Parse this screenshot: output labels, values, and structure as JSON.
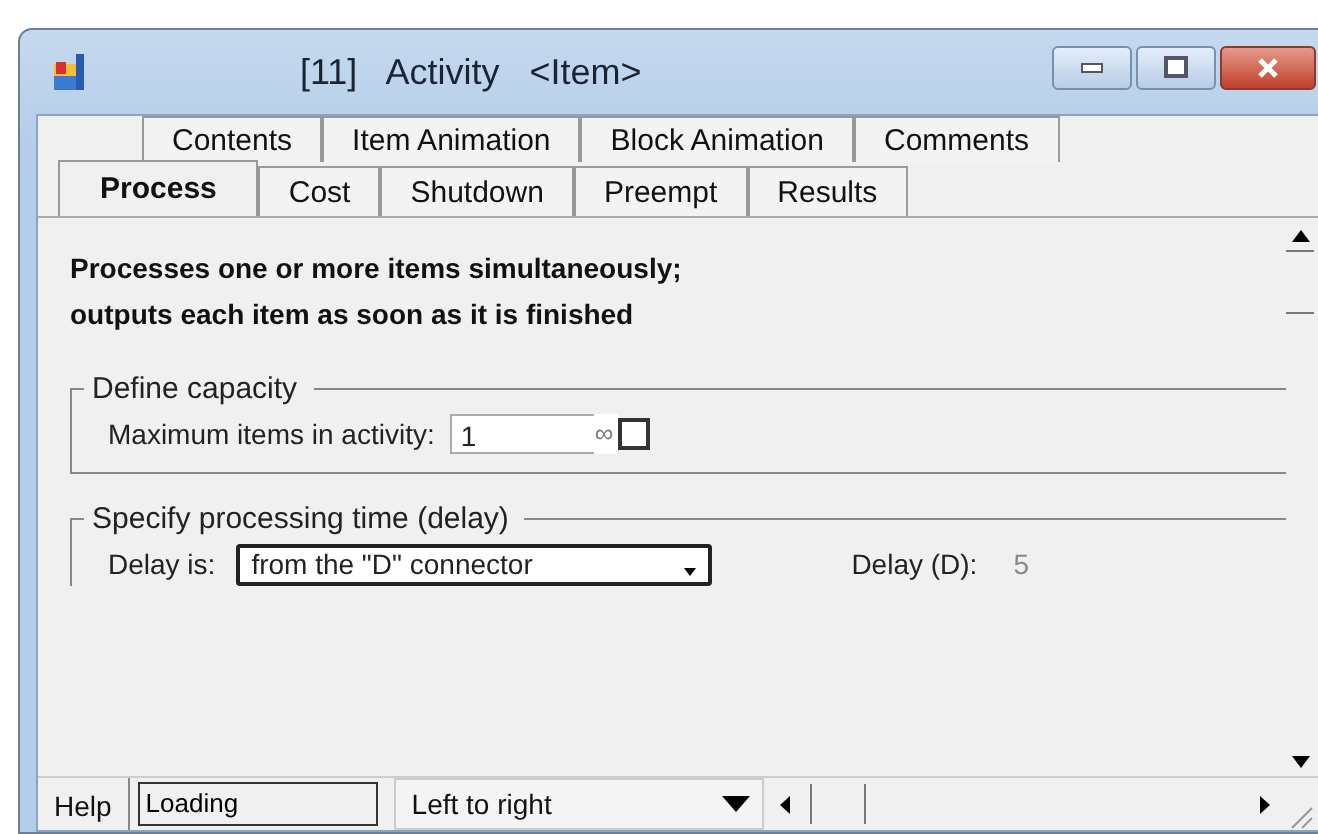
{
  "window": {
    "title": "[11]   Activity   <Item>"
  },
  "tabs_back": [
    {
      "label": "Contents",
      "selected": false
    },
    {
      "label": "Item Animation",
      "selected": false
    },
    {
      "label": "Block Animation",
      "selected": false
    },
    {
      "label": "Comments",
      "selected": false
    }
  ],
  "tabs_front": [
    {
      "label": "Process",
      "selected": true
    },
    {
      "label": "Cost",
      "selected": false
    },
    {
      "label": "Shutdown",
      "selected": false
    },
    {
      "label": "Preempt",
      "selected": false
    },
    {
      "label": "Results",
      "selected": false
    }
  ],
  "description": "Processes one or more items simultaneously;\noutputs each item as soon as it is finished",
  "capacity": {
    "legend": "Define capacity",
    "label": "Maximum items in activity:",
    "value": "1",
    "infinity_symbol": "∞",
    "checked": false
  },
  "delay": {
    "legend": "Specify processing time (delay)",
    "label": "Delay is:",
    "dropdown": "from the \"D\" connector",
    "value_label": "Delay (D):",
    "value": "5"
  },
  "status_bar": {
    "help": "Help",
    "field": "Loading",
    "dropdown": "Left to right"
  }
}
